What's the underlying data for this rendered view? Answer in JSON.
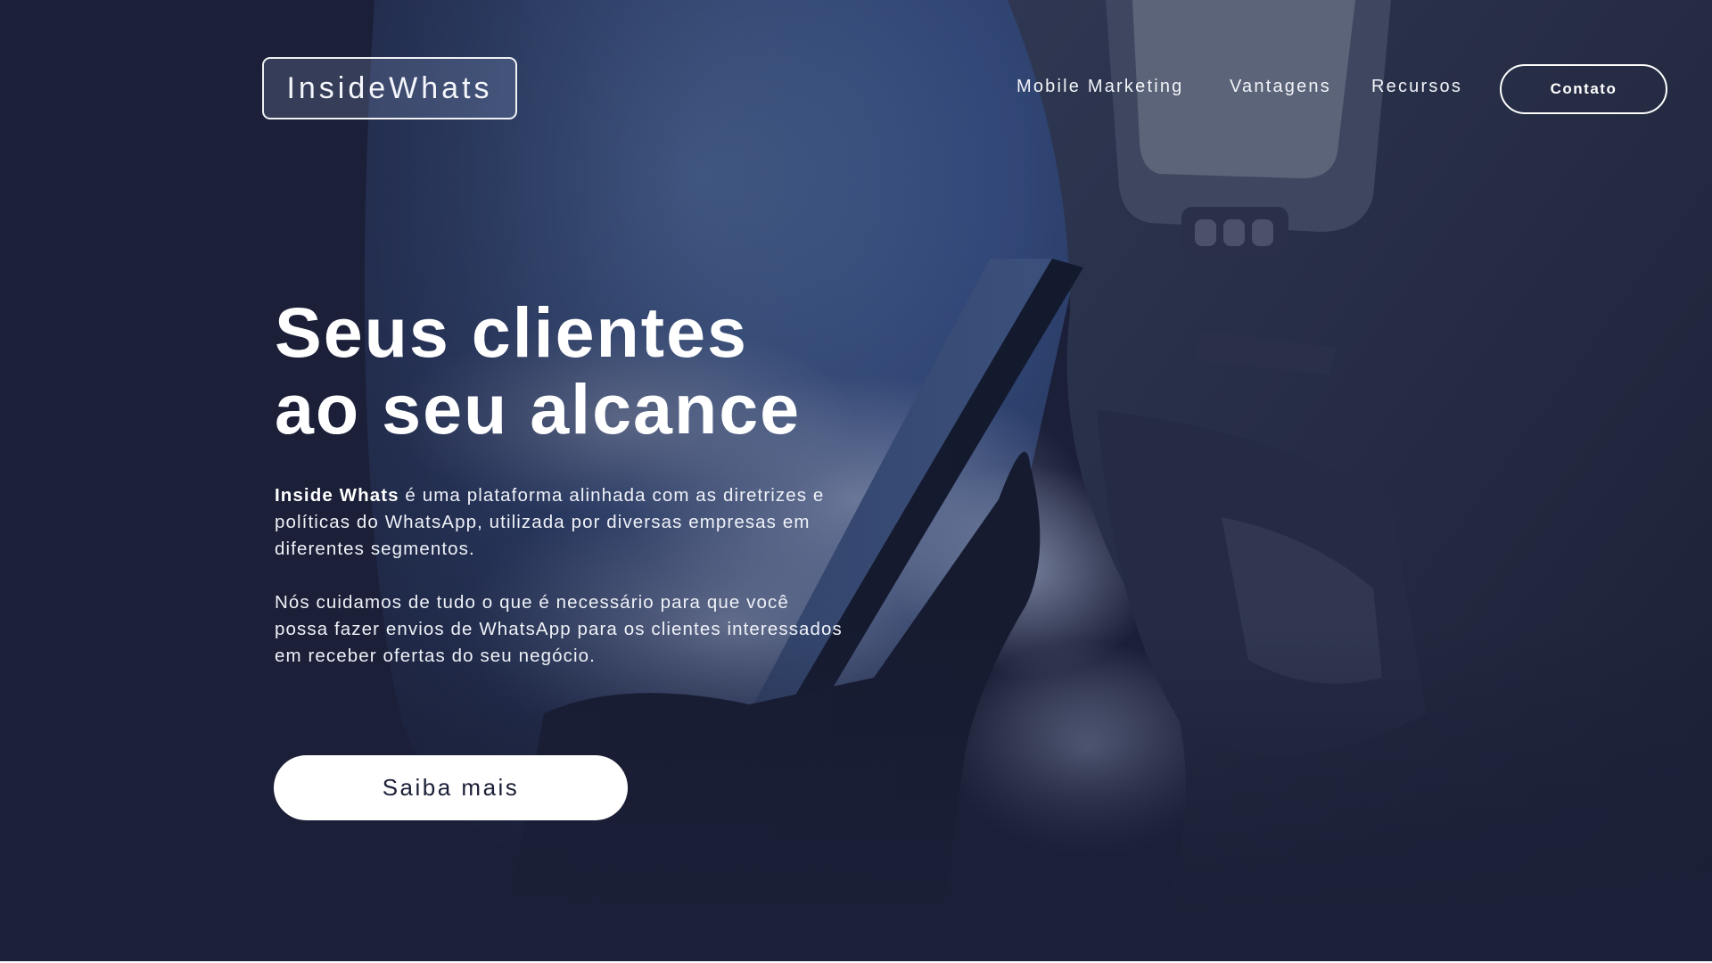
{
  "brand": {
    "logo_text": "InsideWhats"
  },
  "nav": {
    "items": [
      {
        "label": "Mobile Marketing"
      },
      {
        "label": "Vantagens"
      },
      {
        "label": "Recursos"
      }
    ],
    "contact_label": "Contato"
  },
  "hero": {
    "headline_line1": "Seus clientes",
    "headline_line2": "ao seu alcance",
    "para1_bold": "Inside Whats",
    "para1_rest": " é uma plataforma alinhada com as diretrizes e políticas do WhatsApp, utilizada por diversas empresas em diferentes segmentos.",
    "para2": "Nós cuidamos de tudo o que é necessário para que você possa fazer envios de WhatsApp para os clientes interessados em receber ofertas do seu negócio.",
    "cta_label": "Saiba mais"
  },
  "colors": {
    "background": "#1b1f37",
    "text": "#ffffff",
    "cta_text": "#1b1f37"
  },
  "background_image": "airplane-window-hand-holding-phone"
}
